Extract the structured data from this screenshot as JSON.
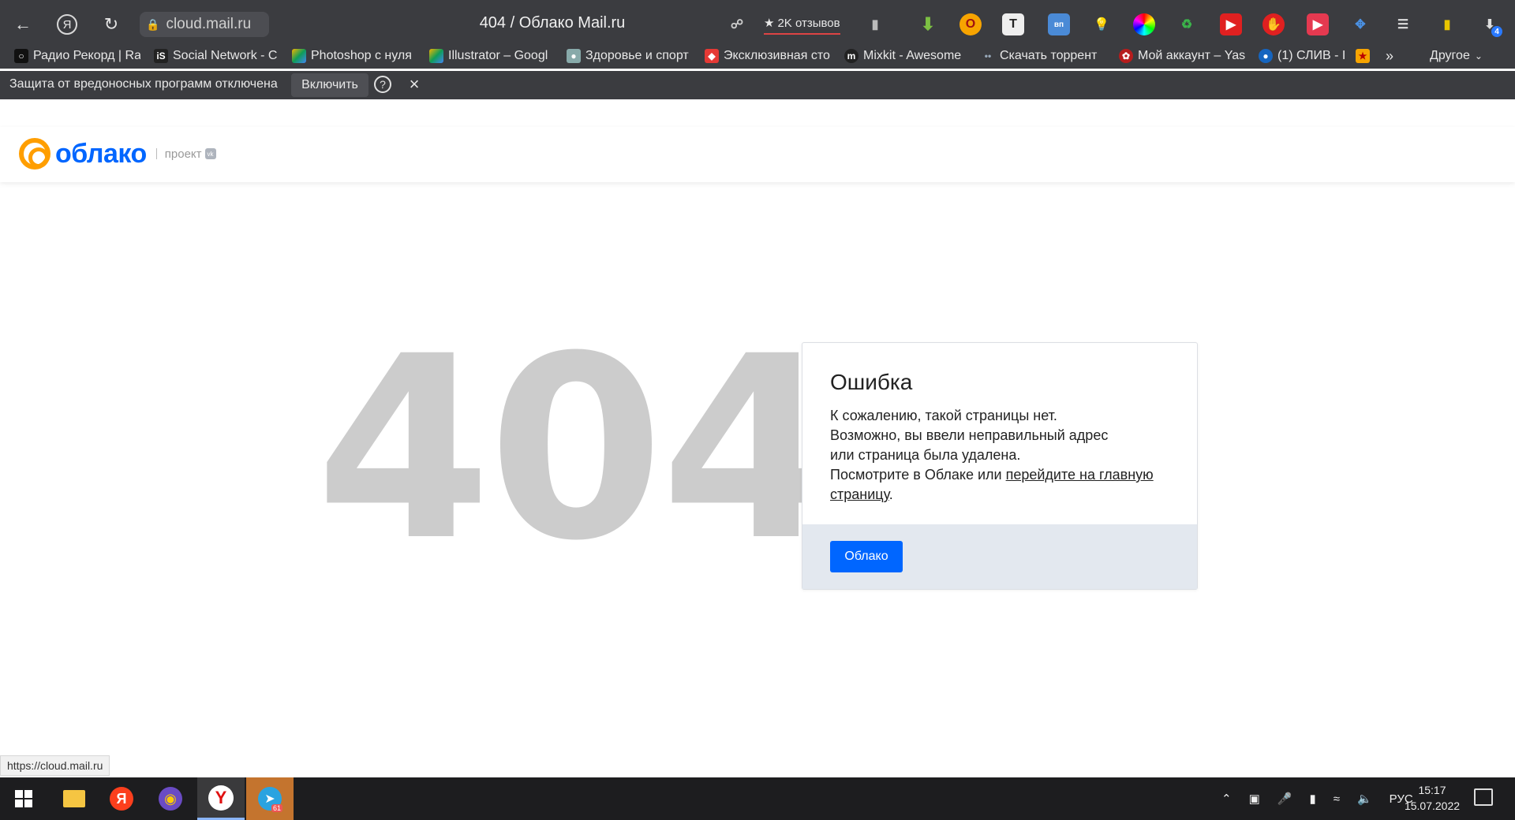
{
  "browser": {
    "url": "cloud.mail.ru",
    "tab_title": "404 / Облако Mail.ru",
    "reviews_label": "2K отзывов",
    "downloads_badge": "4"
  },
  "bookmarks": [
    {
      "label": "Радио Рекорд | Ra",
      "color": "#111111",
      "icon": "record-icon"
    },
    {
      "label": "Social Network - C",
      "color": "#222222",
      "icon": "is-icon"
    },
    {
      "label": "Photoshop с нуля",
      "color": "#f4b400",
      "icon": "drive-icon"
    },
    {
      "label": "Illustrator – Googl",
      "color": "#0f9d58",
      "icon": "drive-icon"
    },
    {
      "label": "Здоровье и спорт",
      "color": "#8aa",
      "icon": "globe-icon"
    },
    {
      "label": "Эксклюзивная сто",
      "color": "#e53935",
      "icon": "exclusive-icon"
    },
    {
      "label": "Mixkit - Awesome",
      "color": "#222222",
      "icon": "mixkit-icon"
    },
    {
      "label": "Скачать торрент -",
      "color": "#5b8fd6",
      "icon": "torrent-icon"
    },
    {
      "label": "Мой аккаунт – Yas",
      "color": "#b71c1c",
      "icon": "account-icon"
    },
    {
      "label": "(1) СЛИВ - I",
      "color": "#1565c0",
      "icon": "sliv-icon"
    }
  ],
  "bookmarks_more": "»",
  "bookmarks_other": "Другое",
  "infobar": {
    "text": "Защита от вредоносных программ отключена",
    "button": "Включить",
    "help": "?",
    "close": "×"
  },
  "site": {
    "logo_text": "облако",
    "project_label": "проект",
    "vk_badge": "vk"
  },
  "error": {
    "code": "404",
    "title": "Ошибка",
    "line1": "К сожалению, такой страницы нет.",
    "line2": "Возможно, вы ввели неправильный адрес",
    "line3": "или страница была удалена.",
    "line4_prefix": "Посмотрите в Облаке или ",
    "line4_link": "перейдите на главную страницу",
    "line4_suffix": ".",
    "button": "Облако"
  },
  "status_url": "https://cloud.mail.ru",
  "taskbar": {
    "telegram_badge": "61",
    "lang": "РУС",
    "time": "15:17",
    "date": "15.07.2022"
  },
  "colors": {
    "accent": "#0066ff",
    "logo_orange": "#ff9e00",
    "browser_bg": "#3b3c40"
  }
}
